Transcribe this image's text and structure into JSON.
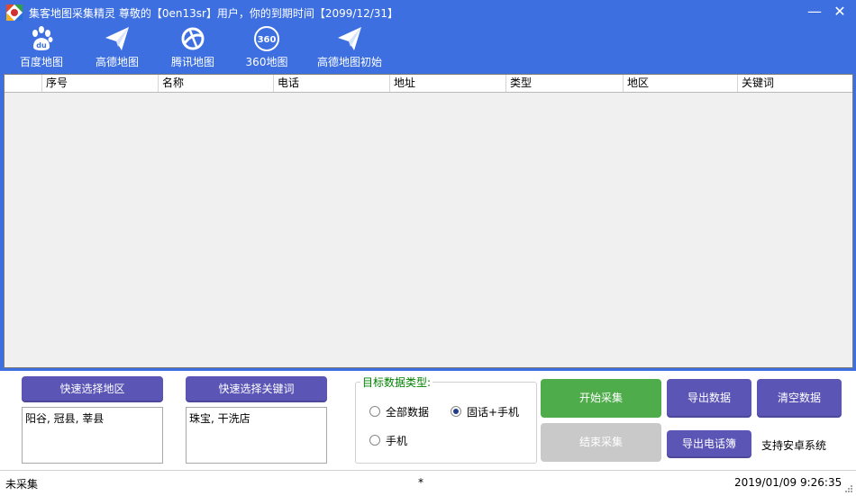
{
  "window": {
    "title": "集客地图采集精灵 尊敬的【0en13sr】用户，你的到期时间【2099/12/31】",
    "minimize_glyph": "—",
    "close_glyph": "✕"
  },
  "toolbar": [
    {
      "label": "百度地图",
      "icon": "baidu-paw-icon"
    },
    {
      "label": "高德地图",
      "icon": "paper-plane-icon"
    },
    {
      "label": "腾讯地图",
      "icon": "tencent-map-icon"
    },
    {
      "label": "360地图",
      "icon": "360-icon"
    },
    {
      "label": "高德地图初始",
      "icon": "paper-plane-icon"
    }
  ],
  "icon_360_text": "360",
  "table": {
    "columns": [
      "序号",
      "名称",
      "电话",
      "地址",
      "类型",
      "地区",
      "关键词"
    ],
    "rows": []
  },
  "controls": {
    "quick_region_label": "快速选择地区",
    "region_value": "阳谷, 冠县, 莘县",
    "quick_keyword_label": "快速选择关键词",
    "keyword_value": "珠宝, 干洗店",
    "target_type_title": "目标数据类型:",
    "options": [
      "全部数据",
      "固话+手机",
      "手机"
    ],
    "selected_option": "固话+手机",
    "start_label": "开始采集",
    "stop_label": "结束采集",
    "export_label": "导出数据",
    "clear_label": "清空数据",
    "export_phonebook_label": "导出电话簿",
    "android_support": "支持安卓系统"
  },
  "status": {
    "left": "未采集",
    "middle": "*",
    "right": "2019/01/09 9:26:35"
  },
  "colors": {
    "window_blue": "#3d6fe0",
    "button_purple": "#5b55b5",
    "button_green": "#4fac4b",
    "button_disabled": "#c9c9c9",
    "group_title_green": "#008000"
  }
}
